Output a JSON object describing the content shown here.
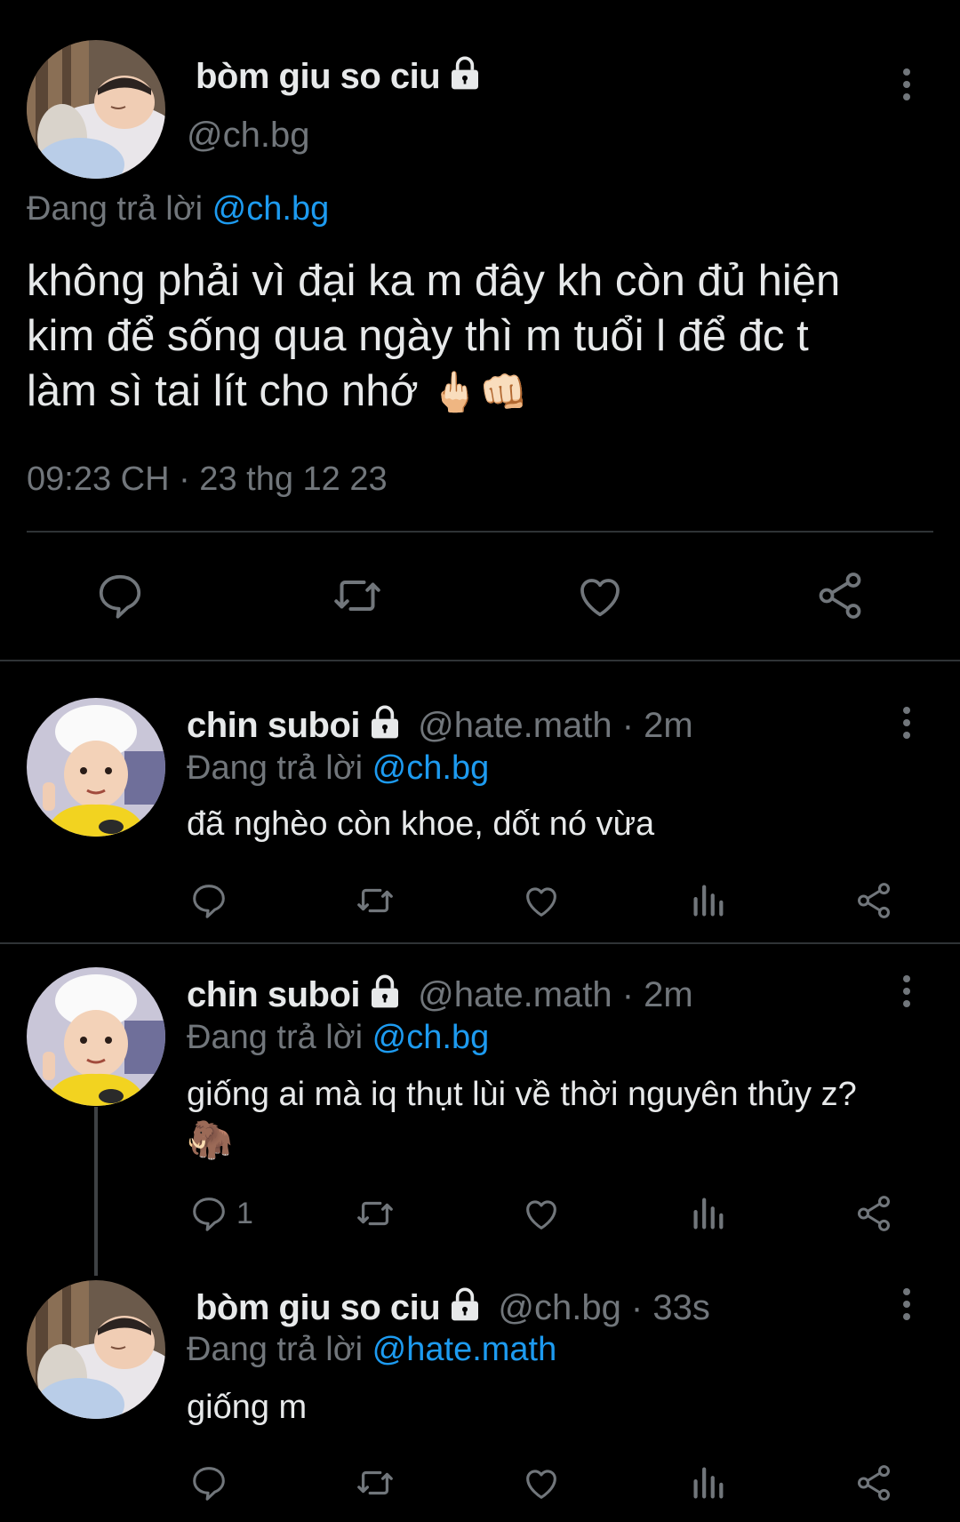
{
  "main_tweet": {
    "display_name": "bòm giu so ciu",
    "handle": "@ch.bg",
    "replying_prefix": "Đang trả lời",
    "replying_to": "@ch.bg",
    "text_line1": "không phải vì đại ka m đây kh còn đủ hiện",
    "text_line2": "kim để sống qua ngày thì m tuổi l để đc t",
    "text_line3": "làm sì tai lít cho nhớ",
    "emoji": "🖕🏻👊🏻",
    "timestamp": "09:23 CH · 23 thg 12 23"
  },
  "replies": [
    {
      "display_name": "chin suboi",
      "handle_time": "@hate.math · 2m",
      "replying_prefix": "Đang trả lời",
      "replying_to": "@ch.bg",
      "text": "đã nghèo còn khoe, dốt nó vừa",
      "emoji": "",
      "reply_count": ""
    },
    {
      "display_name": "chin suboi",
      "handle_time": "@hate.math · 2m",
      "replying_prefix": "Đang trả lời",
      "replying_to": "@ch.bg",
      "text": "giống ai mà iq thụt lùi về thời nguyên thủy z?",
      "emoji": "🦣",
      "reply_count": "1"
    },
    {
      "display_name": "bòm giu so ciu",
      "handle_time": "@ch.bg · 33s",
      "replying_prefix": "Đang trả lời",
      "replying_to": "@hate.math",
      "text": "giống m",
      "emoji": "",
      "reply_count": ""
    }
  ],
  "icons": [
    "more-vertical-icon",
    "lock-icon",
    "reply-icon",
    "retweet-icon",
    "like-icon",
    "views-icon",
    "share-icon"
  ],
  "colors": {
    "background": "#000000",
    "text": "#e7e9ea",
    "secondary": "#71767b",
    "link": "#1d9bf0",
    "divider": "#2f3336"
  }
}
